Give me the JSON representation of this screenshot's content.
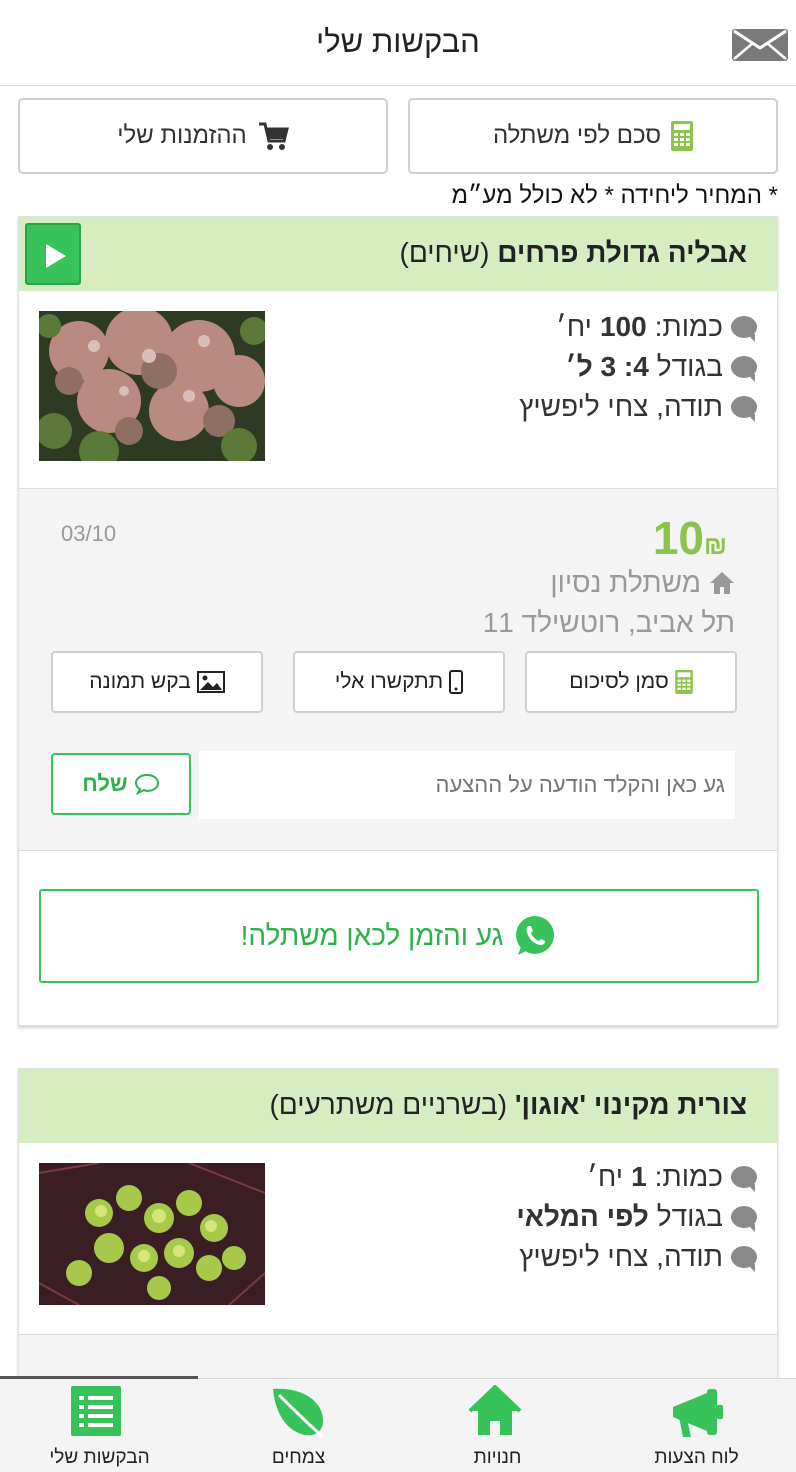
{
  "header": {
    "title": "הבקשות שלי",
    "mail_icon": "envelope-icon"
  },
  "top_buttons": {
    "calc_label": "סכם לפי משתלה",
    "orders_label": "ההזמנות שלי"
  },
  "price_note": "* המחיר ליחידה * לא כולל מע״מ",
  "requests": [
    {
      "name_bold": "אבליה גדולת פרחים",
      "name_rest": " (שיחים)",
      "quantity_label": "כמות:",
      "quantity_value": "100",
      "quantity_unit": "יח׳",
      "size_label": "בגודל",
      "size_value": "4: 3 ל׳",
      "thanks": "תודה, צחי ליפשיץ",
      "offer": {
        "price": "10",
        "currency": "₪",
        "date": "03/10",
        "nursery": "משתלת נסיון",
        "address": "תל אביב, רוטשילד 11",
        "mark_label": "סמן לסיכום",
        "call_label": "תתקשרו אלי",
        "photo_label": "בקש תמונה",
        "message_placeholder": "גע כאן והקלד הודעה על ההצעה",
        "send_label": "שלח"
      },
      "whatsapp_label": "גע והזמן לכאן משתלה!"
    },
    {
      "name_bold": "צורית מקינוי 'אוגון'",
      "name_rest": " (בשרניים משתרעים)",
      "quantity_label": "כמות:",
      "quantity_value": "1",
      "quantity_unit": "יח׳",
      "size_label": "בגודל",
      "size_value": "לפי המלאי",
      "thanks": "תודה, צחי ליפשיץ"
    }
  ],
  "tabbar": {
    "items": [
      {
        "label": "הבקשות שלי",
        "icon": "list-icon"
      },
      {
        "label": "צמחים",
        "icon": "leaf-icon"
      },
      {
        "label": "חנויות",
        "icon": "home-icon"
      },
      {
        "label": "לוח הצעות",
        "icon": "megaphone-icon"
      }
    ]
  },
  "colors": {
    "accent_green": "#37c25a",
    "price_green": "#8cc34a",
    "header_green": "#d6ecc1"
  }
}
